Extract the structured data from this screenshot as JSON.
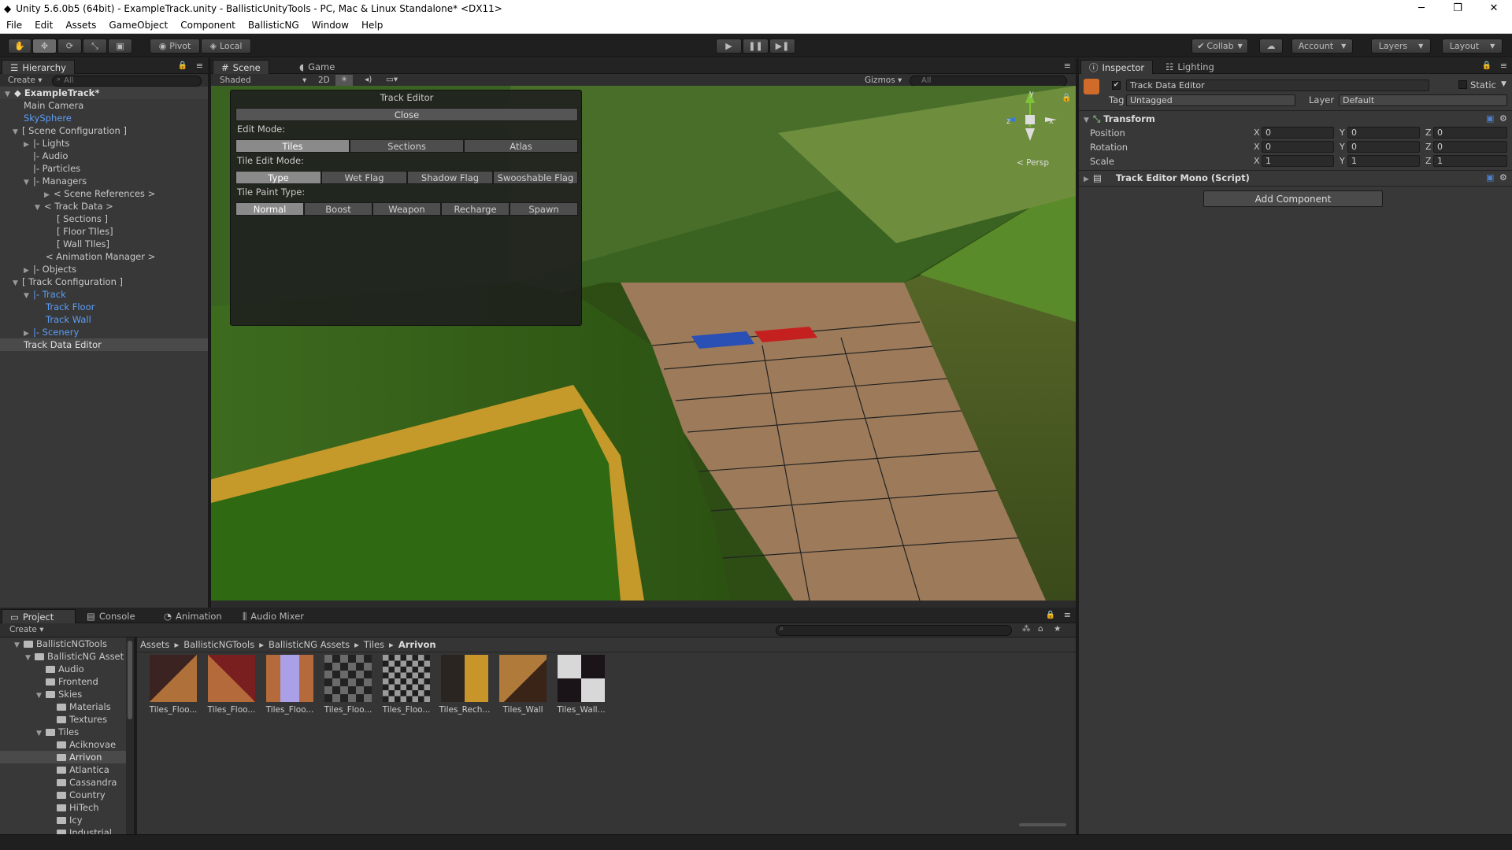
{
  "window": {
    "title": "Unity 5.6.0b5 (64bit) - ExampleTrack.unity - BallisticUnityTools - PC, Mac & Linux Standalone* <DX11>"
  },
  "menu": [
    "File",
    "Edit",
    "Assets",
    "GameObject",
    "Component",
    "BallisticNG",
    "Window",
    "Help"
  ],
  "toolbar": {
    "pivot": "Pivot",
    "local": "Local",
    "collab": "Collab",
    "account": "Account",
    "layers": "Layers",
    "layout": "Layout"
  },
  "hierarchy": {
    "tab": "Hierarchy",
    "create": "Create",
    "search_placeholder": "All",
    "items": [
      {
        "label": "ExampleTrack*"
      },
      {
        "label": "Main Camera"
      },
      {
        "label": "SkySphere"
      },
      {
        "label": "[ Scene Configuration ]"
      },
      {
        "label": "|- Lights"
      },
      {
        "label": "|- Audio"
      },
      {
        "label": "|- Particles"
      },
      {
        "label": "|- Managers"
      },
      {
        "label": "< Scene References >"
      },
      {
        "label": "< Track Data >"
      },
      {
        "label": "[ Sections ]"
      },
      {
        "label": "[ Floor TIles]"
      },
      {
        "label": "[ Wall TIles]"
      },
      {
        "label": "< Animation Manager >"
      },
      {
        "label": "|- Objects"
      },
      {
        "label": "[ Track Configuration ]"
      },
      {
        "label": "|- Track"
      },
      {
        "label": "Track Floor"
      },
      {
        "label": "Track Wall"
      },
      {
        "label": "|- Scenery"
      },
      {
        "label": "Track Data Editor"
      }
    ]
  },
  "scene": {
    "tab_scene": "Scene",
    "tab_game": "Game",
    "shading": "Shaded",
    "mode2d": "2D",
    "gizmos": "Gizmos",
    "search_placeholder": "All",
    "persp": "< Persp",
    "axis_y": "y",
    "axis_x": "x",
    "axis_z": "z"
  },
  "track_editor": {
    "title": "Track Editor",
    "close": "Close",
    "edit_mode_label": "Edit Mode:",
    "edit_modes": [
      "Tiles",
      "Sections",
      "Atlas"
    ],
    "tile_edit_label": "Tile Edit Mode:",
    "tile_edit_modes": [
      "Type",
      "Wet Flag",
      "Shadow Flag",
      "Swooshable Flag"
    ],
    "tile_paint_label": "Tile Paint Type:",
    "tile_paint_types": [
      "Normal",
      "Boost",
      "Weapon",
      "Recharge",
      "Spawn"
    ]
  },
  "inspector": {
    "tab": "Inspector",
    "tab_lighting": "Lighting",
    "object_name": "Track Data Editor",
    "static": "Static",
    "tag_label": "Tag",
    "tag_value": "Untagged",
    "layer_label": "Layer",
    "layer_value": "Default",
    "transform": "Transform",
    "position": "Position",
    "rotation": "Rotation",
    "scale": "Scale",
    "pos": {
      "x": "0",
      "y": "0",
      "z": "0"
    },
    "rot": {
      "x": "0",
      "y": "0",
      "z": "0"
    },
    "scl": {
      "x": "1",
      "y": "1",
      "z": "1"
    },
    "script": "Track Editor Mono (Script)",
    "add_component": "Add Component",
    "axis_x": "X",
    "axis_y": "Y",
    "axis_z": "Z"
  },
  "bottom": {
    "tabs": [
      "Project",
      "Console",
      "Animation",
      "Audio Mixer"
    ],
    "create": "Create",
    "breadcrumb": [
      "Assets",
      "BallisticNGTools",
      "BallisticNG Assets",
      "Tiles",
      "Arrivon"
    ],
    "tree": [
      {
        "label": "BallisticNGTools"
      },
      {
        "label": "BallisticNG Asset"
      },
      {
        "label": "Audio"
      },
      {
        "label": "Frontend"
      },
      {
        "label": "Skies"
      },
      {
        "label": "Materials"
      },
      {
        "label": "Textures"
      },
      {
        "label": "Tiles"
      },
      {
        "label": "Aciknovae"
      },
      {
        "label": "Arrivon"
      },
      {
        "label": "Atlantica"
      },
      {
        "label": "Cassandra"
      },
      {
        "label": "Country"
      },
      {
        "label": "HiTech"
      },
      {
        "label": "Icy"
      },
      {
        "label": "Industrial"
      }
    ],
    "assets": [
      {
        "label": "Tiles_Floo..."
      },
      {
        "label": "Tiles_Floo..."
      },
      {
        "label": "Tiles_Floo..."
      },
      {
        "label": "Tiles_Floo..."
      },
      {
        "label": "Tiles_Floo..."
      },
      {
        "label": "Tiles_Rech..."
      },
      {
        "label": "Tiles_Wall"
      },
      {
        "label": "Tiles_Wall..."
      }
    ]
  }
}
